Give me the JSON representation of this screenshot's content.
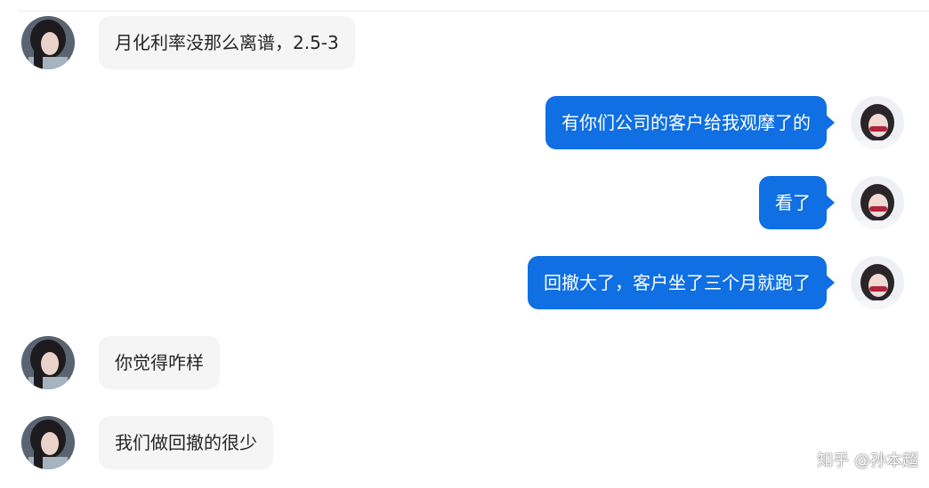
{
  "chat": {
    "messages": [
      {
        "side": "left",
        "text": "月化利率没那么离谱，2.5-3"
      },
      {
        "side": "right",
        "text": "有你们公司的客户给我观摩了的"
      },
      {
        "side": "right",
        "text": "看了"
      },
      {
        "side": "right",
        "text": "回撤大了，客户坐了三个月就跑了"
      },
      {
        "side": "left",
        "text": "你觉得咋样"
      },
      {
        "side": "left",
        "text": "我们做回撤的很少"
      }
    ]
  },
  "watermark": {
    "text": "知乎 @孙本超"
  },
  "colors": {
    "outgoing_bubble": "#0f6fe3",
    "incoming_bubble": "#f5f5f5",
    "incoming_text": "#262626",
    "outgoing_text": "#ffffff"
  }
}
